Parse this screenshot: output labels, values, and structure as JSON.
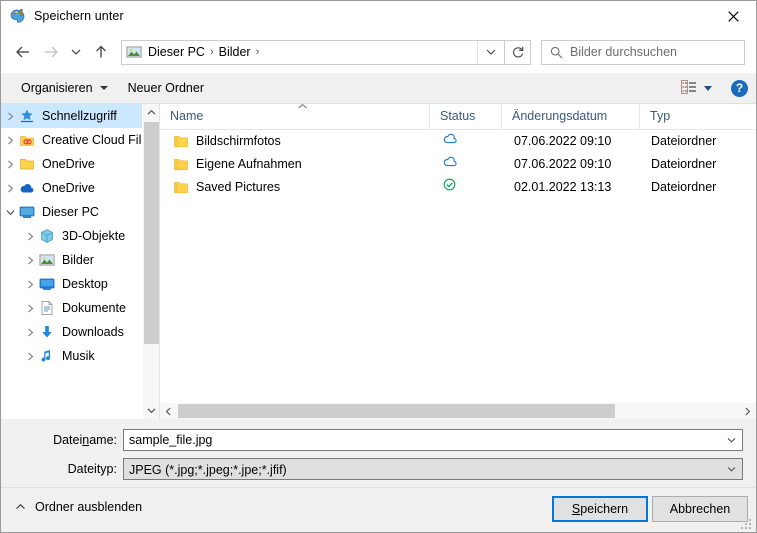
{
  "window": {
    "title": "Speichern unter",
    "icon": "paint-palette-icon",
    "close_label": "✕"
  },
  "nav": {
    "back_icon": "arrow-left-icon",
    "forward_icon": "arrow-right-icon",
    "recent_icon": "chevron-down-icon",
    "up_icon": "arrow-up-icon",
    "breadcrumb": [
      "Dieser PC",
      "Bilder"
    ],
    "separator": "›",
    "dropdown_icon": "chevron-down-icon",
    "refresh_icon": "refresh-icon"
  },
  "search": {
    "placeholder": "Bilder durchsuchen",
    "value": "",
    "icon": "search-icon"
  },
  "toolbar": {
    "organize_label": "Organisieren",
    "new_folder_label": "Neuer Ordner",
    "view_icon": "list-view-icon",
    "help_label": "?"
  },
  "sidebar": {
    "items": [
      {
        "label": "Schnellzugriff",
        "icon": "quick-access-star-icon",
        "selected": true,
        "indent": false
      },
      {
        "label": "Creative Cloud Files",
        "icon": "creative-cloud-icon",
        "selected": false,
        "indent": false
      },
      {
        "label": "OneDrive",
        "icon": "onedrive-folder-icon",
        "selected": false,
        "indent": false
      },
      {
        "label": "OneDrive",
        "icon": "onedrive-cloud-icon",
        "selected": false,
        "indent": false
      },
      {
        "label": "Dieser PC",
        "icon": "this-pc-icon",
        "selected": false,
        "indent": false,
        "expanded": true
      },
      {
        "label": "3D-Objekte",
        "icon": "3d-objects-icon",
        "selected": false,
        "indent": true
      },
      {
        "label": "Bilder",
        "icon": "pictures-icon",
        "selected": false,
        "indent": true
      },
      {
        "label": "Desktop",
        "icon": "desktop-icon",
        "selected": false,
        "indent": true
      },
      {
        "label": "Dokumente",
        "icon": "documents-icon",
        "selected": false,
        "indent": true
      },
      {
        "label": "Downloads",
        "icon": "downloads-icon",
        "selected": false,
        "indent": true
      },
      {
        "label": "Musik",
        "icon": "music-icon",
        "selected": false,
        "indent": true
      }
    ]
  },
  "filelist": {
    "columns": [
      "Name",
      "Status",
      "Änderungsdatum",
      "Typ"
    ],
    "sort_column": "Name",
    "sort_direction": "ascending",
    "rows": [
      {
        "name": "Bildschirmfotos",
        "status_icon": "cloud-outline-icon",
        "date": "07.06.2022 09:10",
        "type": "Dateiordner"
      },
      {
        "name": "Eigene Aufnahmen",
        "status_icon": "cloud-outline-icon",
        "date": "07.06.2022 09:10",
        "type": "Dateiordner"
      },
      {
        "name": "Saved Pictures",
        "status_icon": "green-check-circle-icon",
        "date": "02.01.2022 13:13",
        "type": "Dateiordner"
      }
    ]
  },
  "form": {
    "filename_label": "Dateiname:",
    "filename_value": "sample_file.jpg",
    "filetype_label": "Dateityp:",
    "filetype_value": "JPEG (*.jpg;*.jpeg;*.jpe;*.jfif)"
  },
  "footer": {
    "hide_folders_label": "Ordner ausblenden",
    "hide_folders_icon": "chevron-up-icon",
    "save_label": "Speichern",
    "cancel_label": "Abbrechen"
  },
  "colors": {
    "accent": "#0078d7",
    "selection": "#cce8ff",
    "cloud_blue": "#1976d2",
    "check_green": "#00a14b",
    "folder_yellow": "#ffd24d",
    "header_text": "#3b5a78"
  }
}
